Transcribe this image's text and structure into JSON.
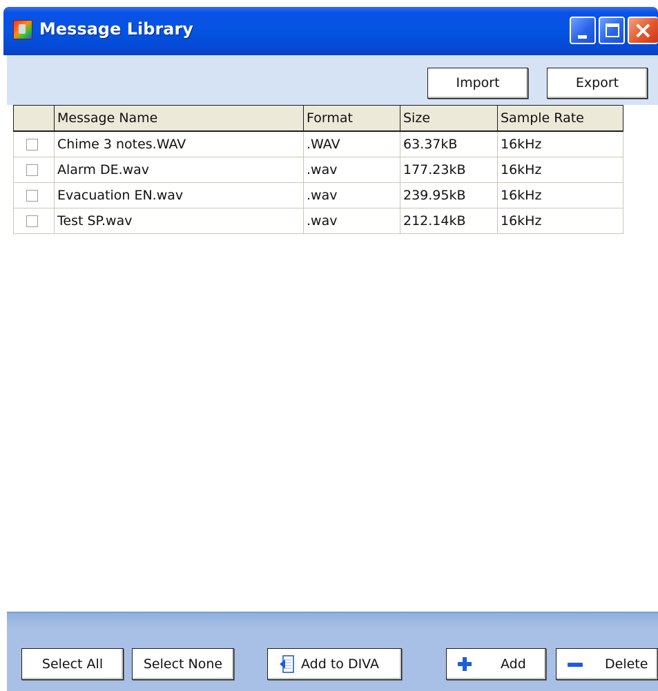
{
  "window": {
    "title": "Message Library"
  },
  "toolbar": {
    "import_label": "Import",
    "export_label": "Export"
  },
  "table": {
    "columns": [
      "",
      "Message Name",
      "Format",
      "Size",
      "Sample Rate"
    ],
    "rows": [
      {
        "checked": false,
        "name": "Chime 3 notes.WAV",
        "format": ".WAV",
        "size": "63.37kB",
        "rate": "16kHz"
      },
      {
        "checked": false,
        "name": "Alarm DE.wav",
        "format": ".wav",
        "size": "177.23kB",
        "rate": "16kHz"
      },
      {
        "checked": false,
        "name": "Evacuation EN.wav",
        "format": ".wav",
        "size": "239.95kB",
        "rate": "16kHz"
      },
      {
        "checked": false,
        "name": "Test SP.wav",
        "format": ".wav",
        "size": "212.14kB",
        "rate": "16kHz"
      }
    ]
  },
  "footer": {
    "select_all_label": "Select All",
    "select_none_label": "Select None",
    "add_to_diva_label": "Add to DIVA",
    "add_label": "Add",
    "delete_label": "Delete"
  },
  "icons": {
    "app": "app-icon",
    "minimize": "minimize-icon",
    "maximize": "maximize-icon",
    "close": "close-icon",
    "add_to_diva": "document-arrow-icon",
    "add": "plus-icon",
    "delete": "minus-icon"
  },
  "colors": {
    "titlebar": "#0454e2",
    "toolbar_bg": "#d6e3f4",
    "footer_bg": "#a9c0e6",
    "header_bg": "#ece9d8"
  }
}
